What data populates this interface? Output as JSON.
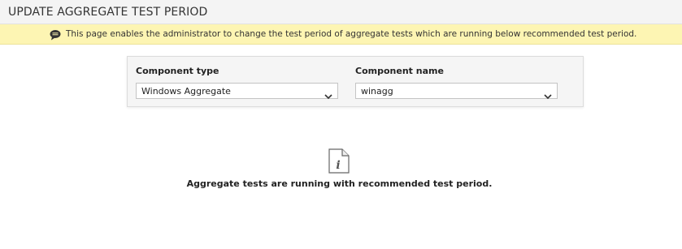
{
  "header": {
    "title": "UPDATE AGGREGATE TEST PERIOD"
  },
  "banner": {
    "icon": "comment-icon",
    "text": "This page enables the administrator to change the test period of aggregate tests which are running below recommended test period."
  },
  "form": {
    "component_type": {
      "label": "Component type",
      "value": "Windows Aggregate"
    },
    "component_name": {
      "label": "Component name",
      "value": "winagg"
    }
  },
  "empty_state": {
    "icon": "info-document-icon",
    "message": "Aggregate tests are running with recommended test period."
  },
  "colors": {
    "banner_background": "#fdf5b3",
    "header_background": "#f4f4f4",
    "panel_background": "#f5f5f5"
  }
}
